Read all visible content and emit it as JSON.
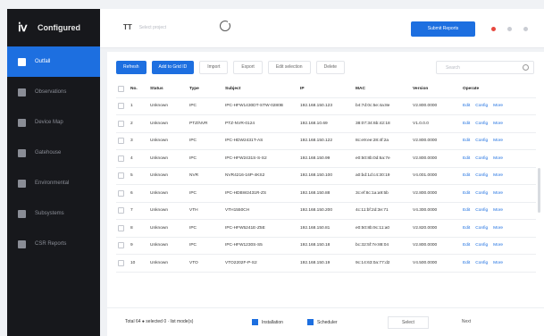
{
  "app": {
    "name": "Configured"
  },
  "sidebar": {
    "items": [
      {
        "label": "Outfall",
        "active": true
      },
      {
        "label": "Observations"
      },
      {
        "label": "Device Map"
      },
      {
        "label": "Gatehouse"
      },
      {
        "label": "Environmental"
      },
      {
        "label": "Subsystems"
      },
      {
        "label": "CSR Reports"
      }
    ]
  },
  "header": {
    "project_text": "Select project",
    "action_label": "Submit Reports",
    "dots": [
      "#e7483f",
      "#c9ccd3",
      "#c9ccd3"
    ]
  },
  "toolbar": {
    "buttons": [
      {
        "label": "Refresh",
        "type": "primary"
      },
      {
        "label": "Add to Grid ID",
        "type": "primary"
      },
      {
        "label": "Import",
        "type": "plain"
      },
      {
        "label": "Export",
        "type": "plain"
      },
      {
        "label": "Edit selection",
        "type": "plain"
      },
      {
        "label": "Delete",
        "type": "plain"
      }
    ],
    "search_placeholder": "Search"
  },
  "table": {
    "headers": [
      "",
      "No.",
      "Status",
      "Type",
      "Subject",
      "IP",
      "MAC",
      "Version",
      "Operate"
    ],
    "rows": [
      [
        "1",
        "Unknown",
        "IPC",
        "IPC-HFW1430DT-STW-0280B",
        "192.168.150.123",
        "b4:7d:0c:5e:4a:8e",
        "V2.800.0000",
        [
          "Edit",
          "Config",
          "More"
        ]
      ],
      [
        "2",
        "Unknown",
        "PTZ/NVR",
        "PTZ-NVR-0124",
        "192.168.10.69",
        "38:07:34:6b:42:18",
        "V1.0.0.0",
        [
          "Edit",
          "Config",
          "More"
        ]
      ],
      [
        "3",
        "Unknown",
        "IPC",
        "IPC-HDW2431T-AS",
        "192.168.150.122",
        "8c:e9:ee:28:4f:2a",
        "V2.800.0000",
        [
          "Edit",
          "Config",
          "More"
        ]
      ],
      [
        "4",
        "Unknown",
        "IPC",
        "IPC-HFW2431S-S-S2",
        "192.168.150.99",
        "e0:50:8b:0d:6a:7e",
        "V2.800.0000",
        [
          "Edit",
          "Config",
          "More"
        ]
      ],
      [
        "5",
        "Unknown",
        "NVR",
        "NVR4216-16P-4KS2",
        "192.168.150.100",
        "a0:bd:1d:c4:30:19",
        "V4.001.0000",
        [
          "Edit",
          "Config",
          "More"
        ]
      ],
      [
        "6",
        "Unknown",
        "IPC",
        "IPC-HDBW2431R-ZS",
        "192.168.150.88",
        "3c:ef:8c:1a:a9:5b",
        "V2.800.0000",
        [
          "Edit",
          "Config",
          "More"
        ]
      ],
      [
        "7",
        "Unknown",
        "VTH",
        "VTH1550CH",
        "192.168.150.200",
        "4c:11:bf:2d:3e:71",
        "V4.300.0000",
        [
          "Edit",
          "Config",
          "More"
        ]
      ],
      [
        "8",
        "Unknown",
        "IPC",
        "IPC-HFW5241E-Z5E",
        "192.168.150.81",
        "e0:50:8b:9c:11:a0",
        "V2.820.0000",
        [
          "Edit",
          "Config",
          "More"
        ]
      ],
      [
        "9",
        "Unknown",
        "IPC",
        "IPC-HFW1230S-S5",
        "192.168.150.18",
        "bc:32:5f:7e:88:04",
        "V2.800.0000",
        [
          "Edit",
          "Config",
          "More"
        ]
      ],
      [
        "10",
        "Unknown",
        "VTO",
        "VTO2202F-P-S2",
        "192.168.150.19",
        "9c:14:63:0a:77:d2",
        "V4.500.0000",
        [
          "Edit",
          "Config",
          "More"
        ]
      ]
    ]
  },
  "footer": {
    "summary": "Total 64 ● selected 0 · list mode(s)",
    "legend": [
      {
        "label": "Installation",
        "color": "#1d6fe0"
      },
      {
        "label": "Scheduler",
        "color": "#1d6fe0"
      }
    ],
    "prev_label": "Select",
    "next_label": "Next"
  }
}
